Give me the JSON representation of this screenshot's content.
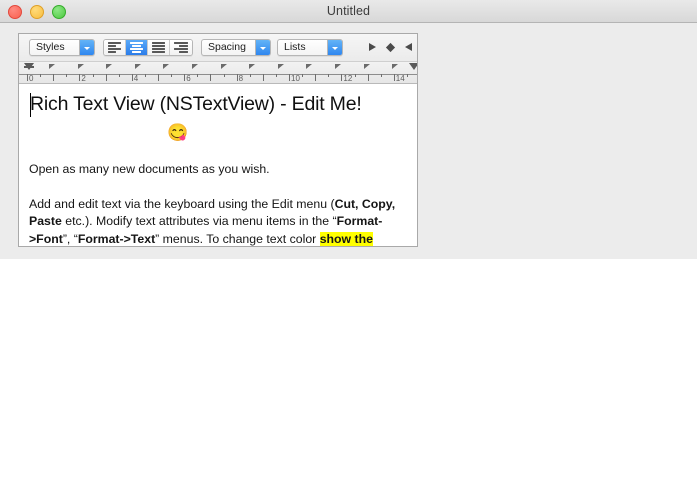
{
  "window": {
    "title": "Untitled",
    "traffic_lights": [
      {
        "name": "close",
        "color": "#f9604f"
      },
      {
        "name": "minimize",
        "color": "#f7bd3f"
      },
      {
        "name": "maximize",
        "color": "#4cc93f"
      }
    ]
  },
  "toolbar": {
    "styles_label": "Styles",
    "spacing_label": "Spacing",
    "lists_label": "Lists",
    "alignment": {
      "options": [
        "align-left",
        "align-center",
        "justify",
        "align-right"
      ],
      "selected": "align-center",
      "selected_color": "#2b7cea"
    },
    "tab_stops": [
      "tab-left-icon",
      "tab-center-icon",
      "tab-right-icon"
    ]
  },
  "ruler": {
    "unit_labels": [
      "0",
      "2",
      "4",
      "6",
      "8",
      "10",
      "12",
      "14"
    ],
    "max_inches": 15,
    "tab_marker_count": 13
  },
  "document": {
    "headline": "Rich Text View (NSTextView) - Edit Me!",
    "emoji": "😋",
    "paragraphs": [
      {
        "id": "p1",
        "runs": [
          {
            "text": "Open as many new documents as you wish.",
            "style": "normal"
          }
        ]
      },
      {
        "id": "p2",
        "runs": [
          {
            "text": "Add and edit text via the keyboard using the Edit menu (",
            "style": "normal"
          },
          {
            "text": "Cut, Copy, Paste",
            "style": "bold"
          },
          {
            "text": " etc.). Modify text attributes via menu items in the “",
            "style": "normal"
          },
          {
            "text": "Format->Font",
            "style": "bold"
          },
          {
            "text": "”, “",
            "style": "normal"
          },
          {
            "text": "Format->Text",
            "style": "bold"
          },
          {
            "text": "” menus. To change text color ",
            "style": "normal"
          },
          {
            "text": "show the",
            "style": "highlight"
          }
        ]
      }
    ],
    "highlight_color": "#ffff00",
    "caret_visible": true
  }
}
